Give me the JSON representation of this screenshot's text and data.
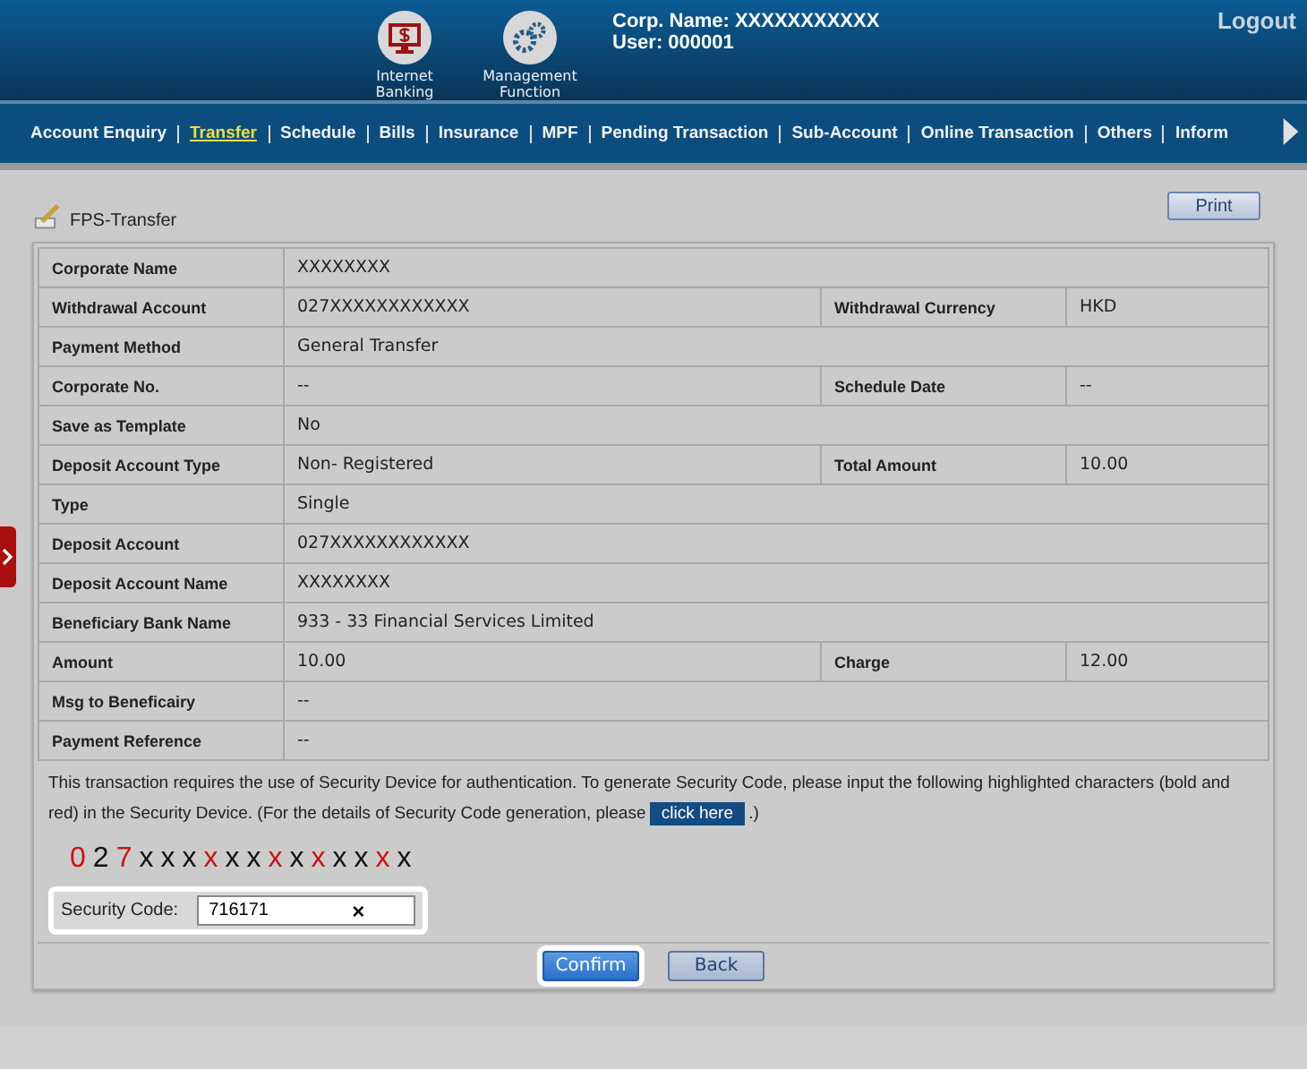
{
  "header": {
    "apps": [
      {
        "label": "Internet Banking",
        "kind": "banking"
      },
      {
        "label": "Management Function",
        "kind": "gears"
      }
    ],
    "corp_name": "Corp. Name: XXXXXXXXXXX",
    "user": "User: 000001",
    "logout": "Logout"
  },
  "nav": [
    {
      "label": "Account Enquiry",
      "selected": false
    },
    {
      "label": "Transfer",
      "selected": true
    },
    {
      "label": "Schedule",
      "selected": false
    },
    {
      "label": "Bills",
      "selected": false
    },
    {
      "label": "Insurance",
      "selected": false
    },
    {
      "label": "MPF",
      "selected": false
    },
    {
      "label": "Pending Transaction",
      "selected": false
    },
    {
      "label": "Sub-Account",
      "selected": false
    },
    {
      "label": "Online Transaction",
      "selected": false
    },
    {
      "label": "Others",
      "selected": false
    },
    {
      "label": "Inform",
      "selected": false
    }
  ],
  "page_title": "FPS-Transfer",
  "print": "Print",
  "rows": [
    {
      "cells": [
        "Corporate Name",
        "XXXXXXXX"
      ]
    },
    {
      "cells": [
        "Withdrawal Account",
        "027XXXXXXXXXXXX",
        "Withdrawal Currency",
        "HKD"
      ]
    },
    {
      "cells": [
        "Payment Method",
        "General Transfer"
      ]
    },
    {
      "cells": [
        "Corporate No.",
        "--",
        "Schedule Date",
        "--"
      ]
    },
    {
      "cells": [
        "Save as Template",
        "No"
      ]
    },
    {
      "cells": [
        "Deposit Account Type",
        "Non- Registered",
        "Total Amount",
        "10.00"
      ]
    },
    {
      "cells": [
        "Type",
        "Single"
      ]
    },
    {
      "cells": [
        "Deposit Account",
        "027XXXXXXXXXXXX"
      ]
    },
    {
      "cells": [
        "Deposit Account Name",
        "XXXXXXXX"
      ]
    },
    {
      "cells": [
        "Beneficiary Bank Name",
        "933 - 33 Financial Services Limited"
      ]
    },
    {
      "cells": [
        "Amount",
        "10.00",
        "Charge",
        "12.00"
      ]
    },
    {
      "cells": [
        "Msg to Beneficairy",
        "--"
      ]
    },
    {
      "cells": [
        "Payment Reference",
        "--"
      ]
    }
  ],
  "notice": "This transaction requires the use of Security Device for authentication. To generate Security Code, please input the following highlighted characters (bold and red) in the Security Device. (For the details of Security Code generation, please",
  "notice_link": "click here",
  "notice_end": ".)",
  "code_chars": [
    {
      "char": "0",
      "highlighted": true
    },
    {
      "char": "2",
      "highlighted": false
    },
    {
      "char": "7",
      "highlighted": true
    },
    {
      "char": "x",
      "highlighted": false
    },
    {
      "char": "x",
      "highlighted": false
    },
    {
      "char": "x",
      "highlighted": false
    },
    {
      "char": "x",
      "highlighted": true
    },
    {
      "char": "x",
      "highlighted": false
    },
    {
      "char": "x",
      "highlighted": false
    },
    {
      "char": "x",
      "highlighted": true
    },
    {
      "char": "x",
      "highlighted": false
    },
    {
      "char": "x",
      "highlighted": true
    },
    {
      "char": "x",
      "highlighted": false
    },
    {
      "char": "x",
      "highlighted": false
    },
    {
      "char": "x",
      "highlighted": true
    },
    {
      "char": "x",
      "highlighted": false
    }
  ],
  "security_label": "Security Code:",
  "security_value": "716171",
  "clear": "×",
  "buttons": [
    {
      "label": "Confirm",
      "kind": "primary"
    },
    {
      "label": "Back",
      "kind": "secondary"
    }
  ]
}
